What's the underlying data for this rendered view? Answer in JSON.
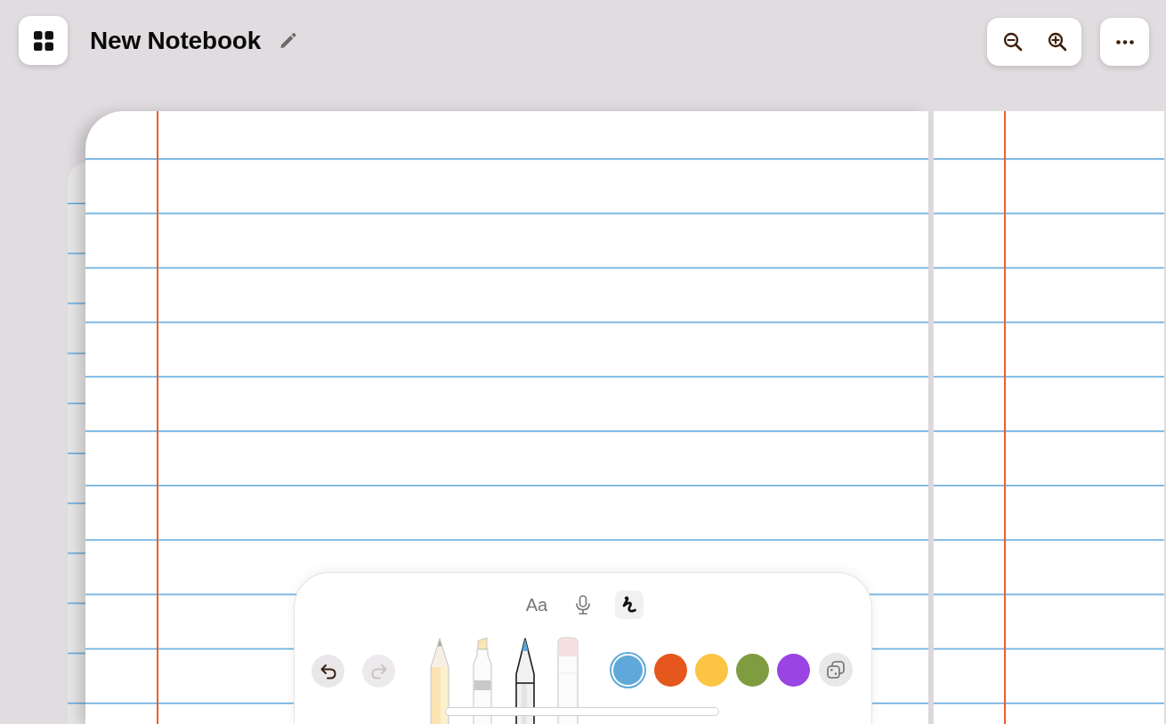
{
  "header": {
    "title": "New Notebook"
  },
  "toolbar": {
    "modes": [
      {
        "kind": "text",
        "label": "Aa",
        "selected": false
      },
      {
        "kind": "voice",
        "selected": false
      },
      {
        "kind": "handwriting",
        "selected": true
      }
    ],
    "undo": {
      "disabled": false
    },
    "redo": {
      "disabled": true
    },
    "tools": [
      {
        "kind": "pencil",
        "selected": false
      },
      {
        "kind": "highlighter",
        "selected": false
      },
      {
        "kind": "pen",
        "selected": true
      },
      {
        "kind": "eraser",
        "selected": false
      }
    ],
    "colors": [
      {
        "color": "#5ea9d9",
        "selected": true
      },
      {
        "color": "#e5571c",
        "selected": false
      },
      {
        "color": "#fcc443",
        "selected": false
      },
      {
        "color": "#7f9c40",
        "selected": false
      },
      {
        "color": "#9a44e3",
        "selected": false
      }
    ]
  }
}
